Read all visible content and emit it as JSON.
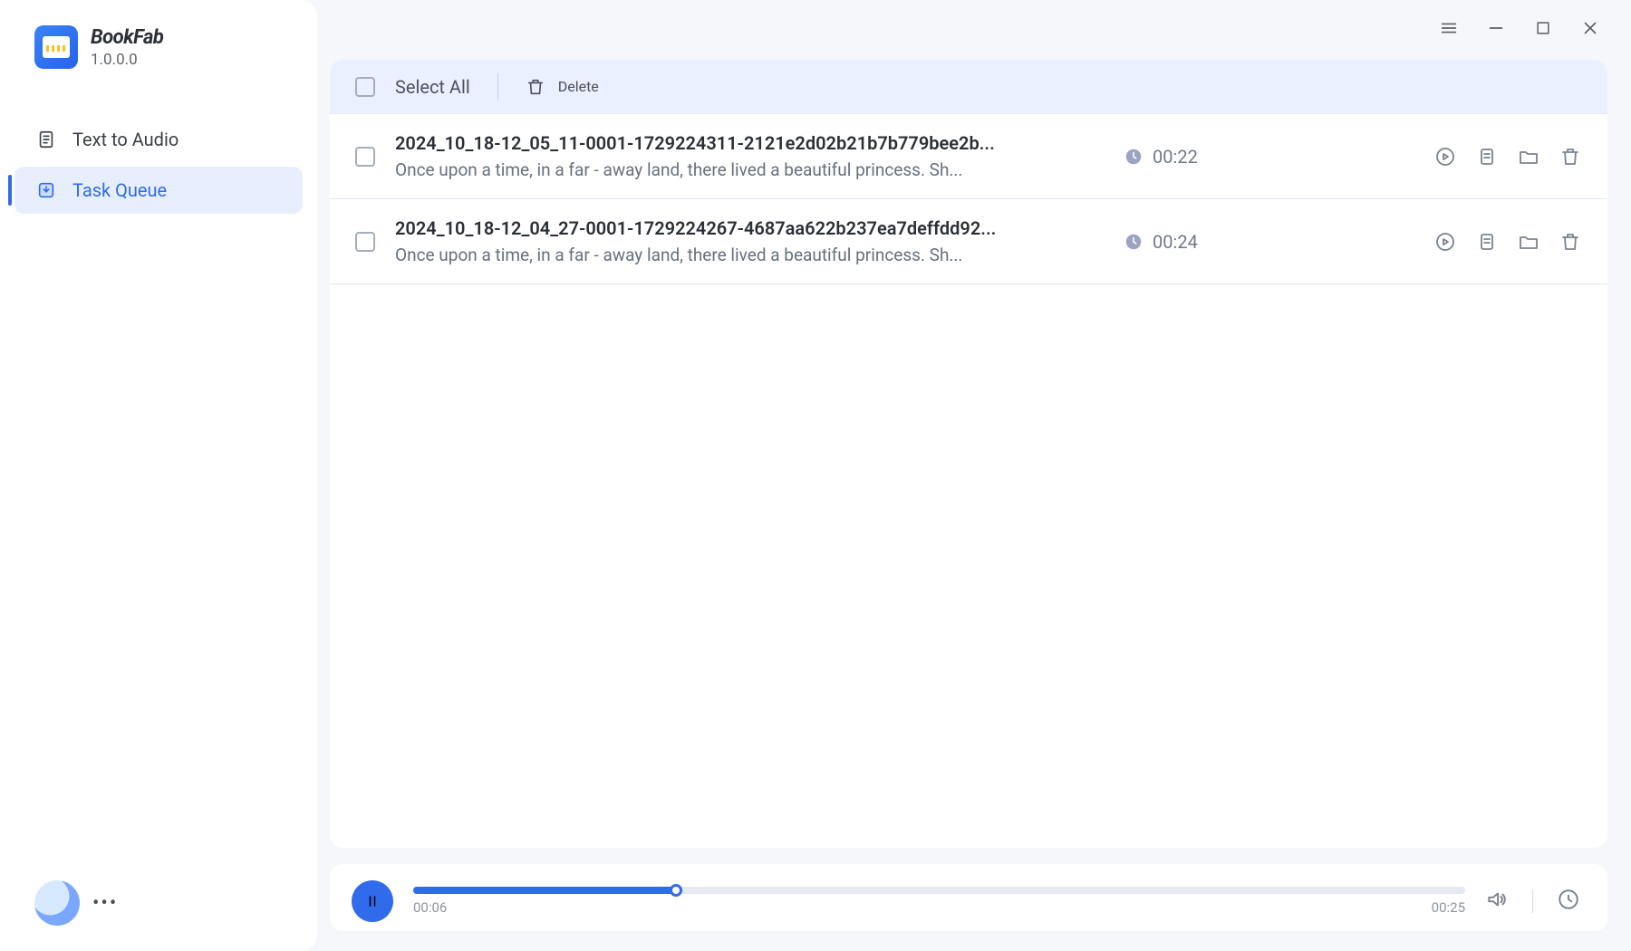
{
  "app": {
    "name": "BookFab",
    "version": "1.0.0.0"
  },
  "sidebar": {
    "items": [
      {
        "label": "Text to Audio"
      },
      {
        "label": "Task Queue"
      }
    ],
    "active_index": 1
  },
  "toolbar": {
    "select_all": "Select All",
    "delete": "Delete"
  },
  "tasks": [
    {
      "title": "2024_10_18-12_05_11-0001-1729224311-2121e2d02b21b7b779bee2b...",
      "subtitle": "Once upon a time, in a far - away land, there lived a beautiful princess. Sh...",
      "duration": "00:22"
    },
    {
      "title": "2024_10_18-12_04_27-0001-1729224267-4687aa622b237ea7deffdd92...",
      "subtitle": "Once upon a time, in a far - away land, there lived a beautiful princess. Sh...",
      "duration": "00:24"
    }
  ],
  "player": {
    "state": "playing",
    "current": "00:06",
    "total": "00:25",
    "progress_percent": 25
  }
}
